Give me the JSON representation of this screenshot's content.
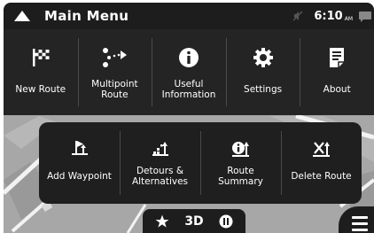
{
  "status_bar": {
    "title": "Main Menu",
    "time": "6:10",
    "ampm": "AM"
  },
  "main_menu": {
    "items": [
      {
        "label": "New Route",
        "icon": "checkered-flag-icon"
      },
      {
        "label": "Multipoint\nRoute",
        "icon": "multipoint-route-icon"
      },
      {
        "label": "Useful\nInformation",
        "icon": "info-icon"
      },
      {
        "label": "Settings",
        "icon": "gear-icon"
      },
      {
        "label": "About",
        "icon": "document-icon"
      }
    ]
  },
  "route_menu": {
    "items": [
      {
        "label": "Add Waypoint",
        "icon": "add-waypoint-icon"
      },
      {
        "label": "Detours &\nAlternatives",
        "icon": "detour-icon"
      },
      {
        "label": "Route\nSummary",
        "icon": "route-summary-icon"
      },
      {
        "label": "Delete Route",
        "icon": "delete-route-icon"
      }
    ]
  },
  "bottom_bar": {
    "view_mode": "3D"
  },
  "colors": {
    "bar": "#1d1d1d",
    "panel": "#242424",
    "map": "#a7a7a7",
    "text": "#ffffff"
  }
}
